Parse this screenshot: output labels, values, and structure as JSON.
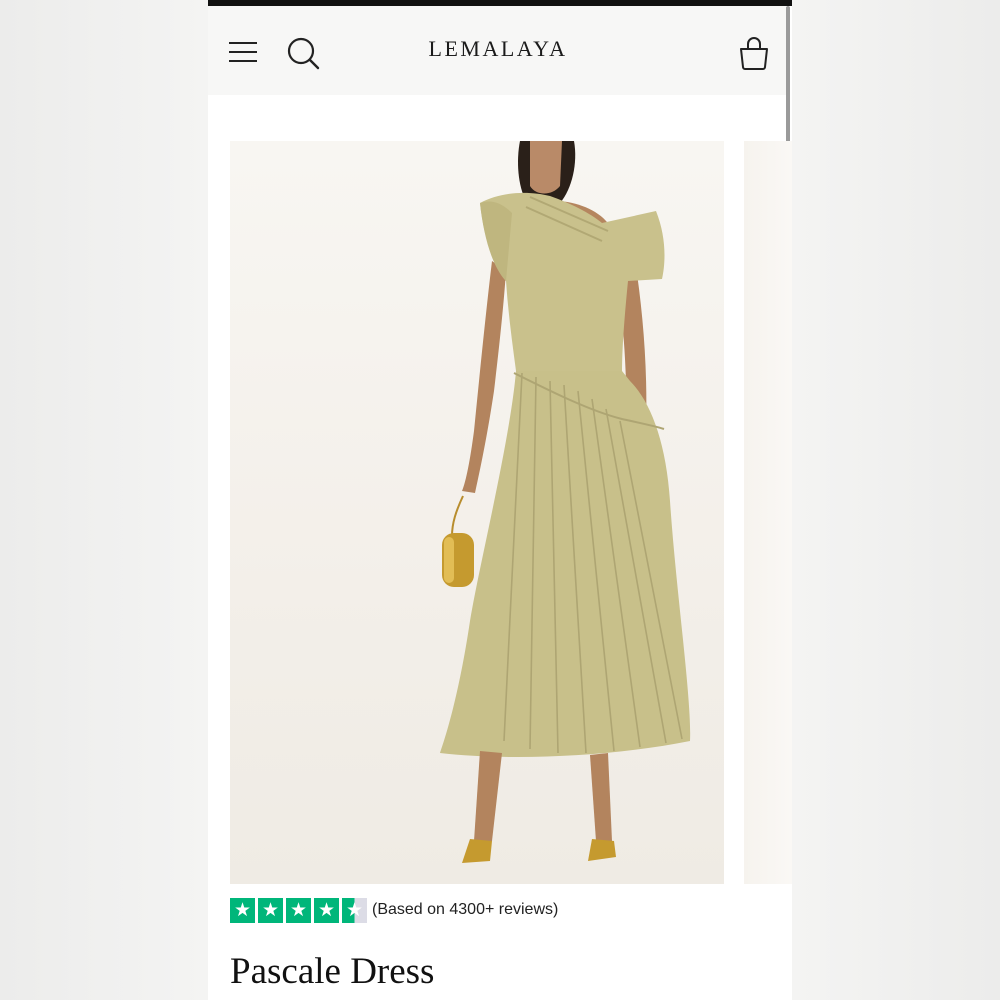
{
  "header": {
    "brand": "LEMALAYA",
    "menu_icon": "hamburger-menu-icon",
    "search_icon": "search-icon",
    "cart_icon": "shopping-bag-icon"
  },
  "product": {
    "title": "Pascale Dress",
    "rating_text": "(Based on 4300+ reviews)",
    "rating_stars": 4.5,
    "rating_max": 5
  },
  "colors": {
    "star_green": "#00b67a",
    "dress_color": "#c8c08a",
    "header_bg": "#f7f7f6"
  }
}
